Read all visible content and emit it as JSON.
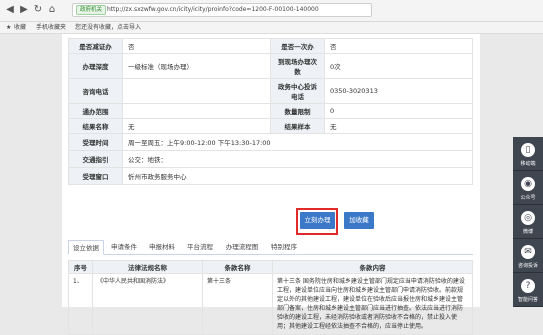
{
  "browser": {
    "badge": "政府机关",
    "url": "http://zx.sxzwfw.gov.cn/icity/icity/proinfo?code=1200-F-00100-140000",
    "bookmarks": [
      "收藏",
      "手机收藏夹",
      "您还没有收藏，点击导入"
    ]
  },
  "info_rows": [
    {
      "l1": "是否减证办",
      "v1": "否",
      "l2": "是否一次办",
      "v2": "否",
      "cls": ""
    },
    {
      "l1": "办理深度",
      "v1": "一级标准（现场办理）",
      "l2": "到现场办理次数",
      "v2": "0次",
      "cls": ""
    },
    {
      "l1": "咨询电话",
      "v1": "",
      "l2": "政务中心投诉电话",
      "v2": "0350-3020313",
      "cls": "tall"
    },
    {
      "l1": "通办范围",
      "v1": "",
      "l2": "数量限制",
      "v2": "0",
      "cls": ""
    },
    {
      "l1": "结果名称",
      "v1": "无",
      "l2": "结果样本",
      "v2": "无",
      "cls": ""
    }
  ],
  "wide_rows": [
    {
      "label": "受理时间",
      "value": "周一至周五：上午9:00-12:00 下午13:30-17:00"
    },
    {
      "label": "交通指引",
      "value": "公交：地铁："
    },
    {
      "label": "受理窗口",
      "value": "忻州市政务服务中心"
    }
  ],
  "buttons": {
    "apply": "立刻办理",
    "favorite": "加收藏"
  },
  "tabs": [
    "设立依据",
    "申请条件",
    "申报材料",
    "平台流程",
    "办理流程图",
    "特别程序"
  ],
  "clauses": {
    "headers": [
      "序号",
      "法律法规名称",
      "条款名称",
      "条款内容"
    ],
    "rows": [
      {
        "no": "1、",
        "law": "《中华人民共和国消防法》",
        "clause": "第十三条",
        "content": "第十三条 国务院住房和城乡建设主管部门规定应当申请消防验收的建设工程，建设单位应当向住房和城乡建设主管部门申请消防验收。前款规定以外的其他建设工程，建设单位在验收后应当报住房和城乡建设主管部门备案，住房和城乡建设主管部门应当进行抽查。依法应当进行消防验收的建设工程，未经消防验收或者消防验收不合格的，禁止投入使用；其他建设工程经依法抽查不合格的，应当停止使用。"
      }
    ]
  },
  "rail": [
    "移动端",
    "公众号",
    "微博",
    "咨询投诉",
    "智能问答"
  ]
}
